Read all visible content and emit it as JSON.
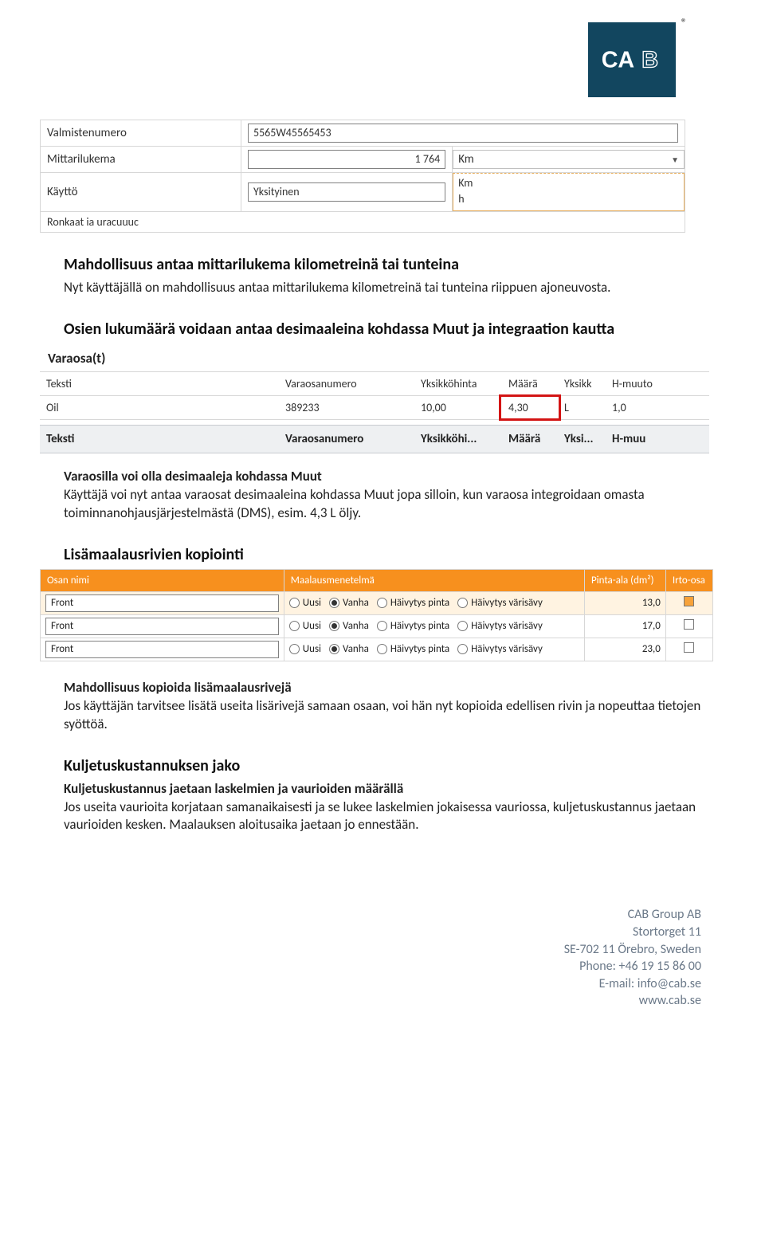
{
  "logo_text": "CAB",
  "form1": {
    "labels": {
      "valmistenumero": "Valmistenumero",
      "mittarilukema": "Mittarilukema",
      "kaytto": "Käyttö"
    },
    "values": {
      "valmistenumero": "5565W45565453",
      "mittarilukema": "1 764",
      "kaytto": "Yksityinen"
    },
    "unit_selected": "Km",
    "unit_options": [
      "Km",
      "h"
    ],
    "truncated_row_label": "Ronkaat ia uracuuuc"
  },
  "s1": {
    "heading": "Mahdollisuus antaa mittarilukema kilometreinä tai tunteina",
    "body": "Nyt käyttäjällä on mahdollisuus antaa mittarilukema kilometreinä tai tunteina riippuen ajoneuvosta."
  },
  "s2": {
    "heading": "Osien lukumäärä voidaan antaa desimaaleina kohdassa Muut ja integraation kautta"
  },
  "varaosa": {
    "title": "Varaosa(t)",
    "cols_top": [
      "Teksti",
      "Varaosanumero",
      "Yksikköhinta",
      "Määrä",
      "Yksikk",
      "H-muuto"
    ],
    "row": {
      "teksti": "Oil",
      "nro": "389233",
      "hinta": "10,00",
      "maara": "4,30",
      "yks": "L",
      "hmuuto": "1,0"
    },
    "cols_bottom": [
      "Teksti",
      "Varaosanumero",
      "Yksikköhi...",
      "Määrä",
      "Yksi...",
      "H-muu"
    ]
  },
  "s3": {
    "sub_bold": "Varaosilla voi olla desimaaleja kohdassa Muut",
    "body": "Käyttäjä voi nyt antaa varaosat desimaaleina kohdassa Muut jopa silloin, kun varaosa integroidaan omasta toiminnanohjausjärjestelmästä (DMS), esim. 4,3 L öljy."
  },
  "s4": {
    "heading": "Lisämaalausrivien kopiointi"
  },
  "paint": {
    "cols": [
      "Osan nimi",
      "Maalausmenetelmä",
      "Pinta-ala (dm²)",
      "Irto-osa"
    ],
    "opts": [
      "Uusi",
      "Vanha",
      "Häivytys pinta",
      "Häivytys värisävy"
    ],
    "selected_opt_index": 1,
    "rows": [
      {
        "name": "Front",
        "area": "13,0",
        "selected": true
      },
      {
        "name": "Front",
        "area": "17,0",
        "selected": false
      },
      {
        "name": "Front",
        "area": "23,0",
        "selected": false
      }
    ]
  },
  "s5": {
    "sub_bold": "Mahdollisuus kopioida lisämaalausrivejä",
    "body": "Jos käyttäjän tarvitsee lisätä useita lisärivejä samaan osaan, voi hän nyt kopioida edellisen rivin ja nopeuttaa tietojen syöttöä."
  },
  "s6": {
    "heading": "Kuljetuskustannuksen jako"
  },
  "s7": {
    "sub_bold": "Kuljetuskustannus jaetaan laskelmien ja vaurioiden määrällä",
    "body": "Jos useita vaurioita korjataan samanaikaisesti ja se lukee laskelmien jokaisessa vauriossa, kuljetuskustannus jaetaan vaurioiden kesken. Maalauksen aloitusaika jaetaan jo ennestään."
  },
  "footer": {
    "l1": "CAB Group AB",
    "l2": "Stortorget 11",
    "l3": "SE-702 11 Örebro, Sweden",
    "l4": "Phone: +46 19 15 86 00",
    "l5": "E-mail: info@cab.se",
    "l6": "www.cab.se"
  }
}
